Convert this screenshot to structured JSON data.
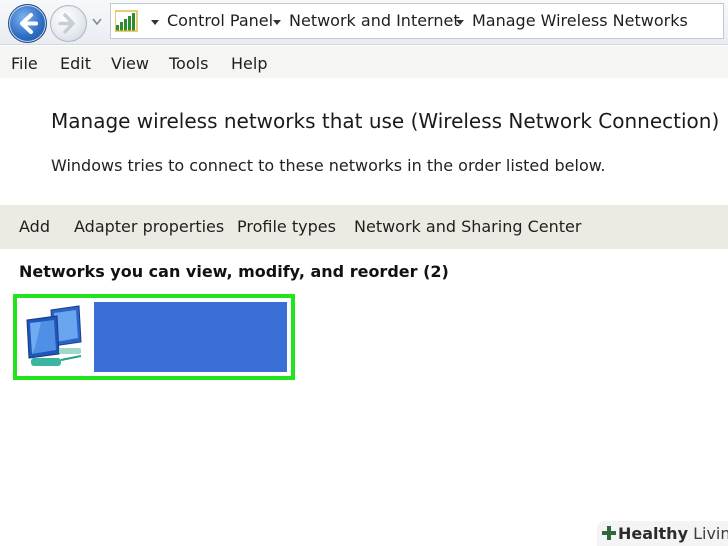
{
  "breadcrumb": {
    "items": [
      "Control Panel",
      "Network and Internet",
      "Manage Wireless Networks"
    ]
  },
  "menu": {
    "items": [
      "File",
      "Edit",
      "View",
      "Tools",
      "Help"
    ]
  },
  "header": {
    "title": "Manage wireless networks that use (Wireless Network Connection)",
    "subtitle": "Windows tries to connect to these networks in the order listed below."
  },
  "toolbar": {
    "items": [
      "Add",
      "Adapter properties",
      "Profile types",
      "Network and Sharing Center"
    ]
  },
  "networks": {
    "section_label": "Networks you can view, modify, and reorder (2)",
    "selection_color": "#3a6fd6",
    "highlight_color": "#21e51c"
  },
  "watermark": {
    "brand_bold": "Healthy",
    "brand_rest": "Living",
    "icon": "plus-logo-icon"
  },
  "icons": {
    "back": "back-arrow-icon",
    "forward": "forward-arrow-icon",
    "signal": "signal-bars-icon",
    "network": "network-computers-icon"
  }
}
